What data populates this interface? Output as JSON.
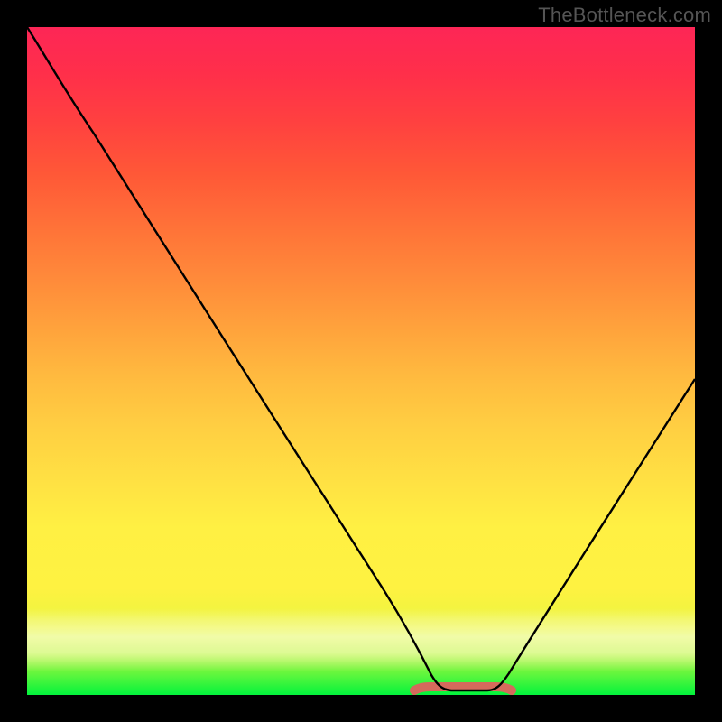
{
  "watermark": "TheBottleneck.com",
  "chart_data": {
    "type": "line",
    "title": "",
    "xlabel": "",
    "ylabel": "",
    "xlim": [
      0,
      100
    ],
    "ylim": [
      0,
      100
    ],
    "grid": false,
    "legend": false,
    "background": "red-yellow-green vertical gradient",
    "series": [
      {
        "name": "bottleneck-curve",
        "x": [
          0,
          5,
          10,
          15,
          20,
          25,
          30,
          35,
          40,
          45,
          50,
          55,
          58,
          63,
          70,
          73,
          78,
          84,
          90,
          95,
          100
        ],
        "values": [
          100,
          93,
          85,
          77,
          68,
          59,
          50,
          41,
          32,
          23,
          14,
          6,
          1,
          0,
          0,
          1,
          7,
          16,
          27,
          36,
          46
        ]
      }
    ],
    "annotations": [
      {
        "name": "trough-marker",
        "shape": "segment",
        "color": "#d56a5c",
        "x_range": [
          58,
          73
        ],
        "y": 0.3
      }
    ],
    "colors": {
      "top": "#fd2656",
      "mid": "#ffe143",
      "bottom": "#02f33c",
      "curve": "#000000",
      "trough": "#d56a5c",
      "frame": "#000000"
    }
  }
}
